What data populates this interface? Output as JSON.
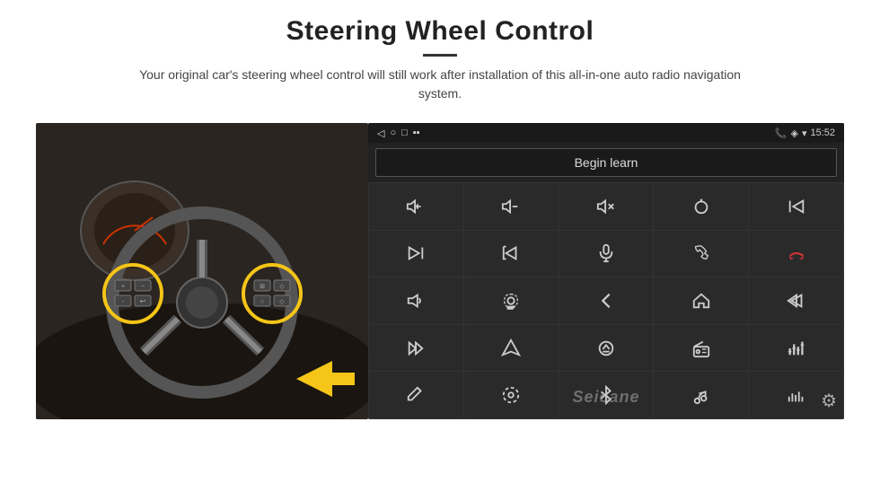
{
  "title": "Steering Wheel Control",
  "subtitle": "Your original car's steering wheel control will still work after installation of this all-in-one auto radio navigation system.",
  "divider": "",
  "screen": {
    "status_bar": {
      "back_icon": "◁",
      "circle_icon": "○",
      "square_icon": "□",
      "signal_icon": "▪▪",
      "phone_icon": "📞",
      "location_icon": "◈",
      "wifi_icon": "▾",
      "time": "15:52"
    },
    "begin_learn_label": "Begin learn",
    "watermark": "Seicane",
    "gear_icon": "⚙",
    "icons": [
      {
        "row": 1,
        "cells": [
          "vol+",
          "vol-",
          "mute",
          "power",
          "prev-track"
        ]
      },
      {
        "row": 2,
        "cells": [
          "next",
          "skip-back",
          "mic",
          "phone",
          "hang-up"
        ]
      },
      {
        "row": 3,
        "cells": [
          "horn",
          "360-cam",
          "back",
          "home",
          "skip-back2"
        ]
      },
      {
        "row": 4,
        "cells": [
          "fast-fwd",
          "nav",
          "eject",
          "radio",
          "equalizer"
        ]
      },
      {
        "row": 5,
        "cells": [
          "pen",
          "settings2",
          "bluetooth",
          "music",
          "bars"
        ]
      }
    ]
  }
}
